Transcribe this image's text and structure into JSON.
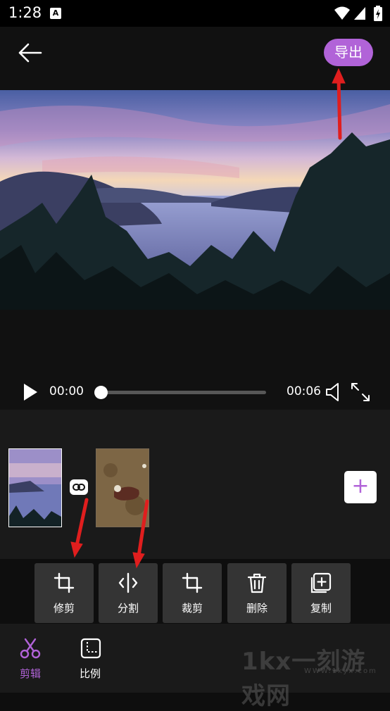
{
  "status_bar": {
    "time": "1:28",
    "notification_icon": "A"
  },
  "header": {
    "export_label": "导出"
  },
  "player": {
    "current_time": "00:00",
    "total_time": "00:06",
    "progress": 0.0
  },
  "tools": [
    {
      "label": "修剪",
      "icon": "trim-icon"
    },
    {
      "label": "分割",
      "icon": "split-icon"
    },
    {
      "label": "裁剪",
      "icon": "crop-icon"
    },
    {
      "label": "删除",
      "icon": "trash-icon"
    },
    {
      "label": "复制",
      "icon": "copy-icon"
    }
  ],
  "bottom_nav": [
    {
      "label": "剪辑",
      "icon": "scissors-icon",
      "active": true
    },
    {
      "label": "比例",
      "icon": "ratio-icon",
      "active": false
    }
  ],
  "colors": {
    "accent": "#b163d8",
    "background": "#0e0e0e",
    "tool_bg": "#343434",
    "annotation_arrow": "#e01e1e"
  },
  "watermark": {
    "text": "1kx一刻游戏网",
    "url": "WWW.1kyx.com"
  }
}
